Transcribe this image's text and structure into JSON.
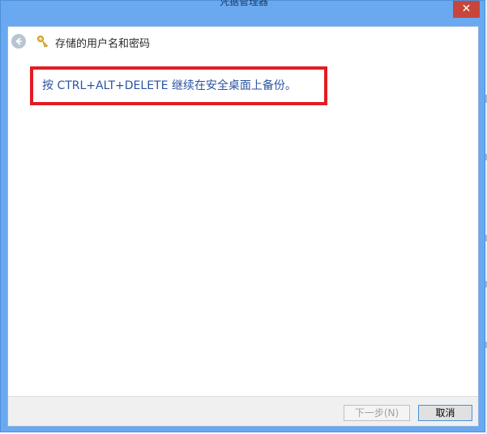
{
  "window": {
    "title": "凭据管理器",
    "close_label": "✕"
  },
  "header": {
    "title": "存储的用户名和密码",
    "back_icon": "back-arrow-icon",
    "key_icon": "key-icon"
  },
  "content": {
    "message": "按 CTRL+ALT+DELETE 继续在安全桌面上备份。"
  },
  "footer": {
    "next_label": "下一步(N)",
    "cancel_label": "取消"
  },
  "colors": {
    "window_frame": "#6aa9f0",
    "message_text": "#2a54a1",
    "highlight_border": "#e31b23",
    "close_button": "#c7463c"
  }
}
